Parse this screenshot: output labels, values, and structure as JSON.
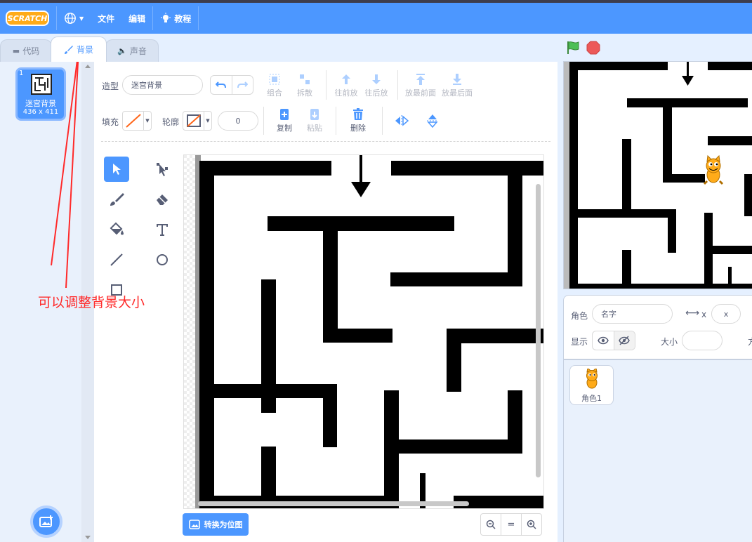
{
  "menubar": {
    "logo": "SCRATCH",
    "file": "文件",
    "edit": "编辑",
    "tutorials": "教程"
  },
  "tabs": {
    "code": "代码",
    "backdrops": "背景",
    "sounds": "声音"
  },
  "costume": {
    "number": "1",
    "name": "迷宫背景",
    "size": "436 x 411"
  },
  "paint": {
    "costume_label": "造型",
    "costume_name": "迷宫背景",
    "group": "组合",
    "ungroup": "拆散",
    "forward": "往前放",
    "backward": "往后放",
    "front": "放最前面",
    "back": "放最后面",
    "fill_label": "填充",
    "outline_label": "轮廓",
    "outline_width": "0",
    "copy": "复制",
    "paste": "粘贴",
    "delete": "删除",
    "convert": "转换为位图",
    "zoom_reset": "="
  },
  "annotation": {
    "text": "可以调整背景大小"
  },
  "sprite_info": {
    "sprite_label": "角色",
    "name_placeholder": "名字",
    "x_label": "x",
    "x_placeholder": "x",
    "show_label": "显示",
    "size_label": "大小",
    "dir_partial": "方"
  },
  "sprites": [
    {
      "name": "角色1"
    }
  ],
  "colors": {
    "brand": "#4c97ff",
    "annotation": "#ff2a2a"
  }
}
